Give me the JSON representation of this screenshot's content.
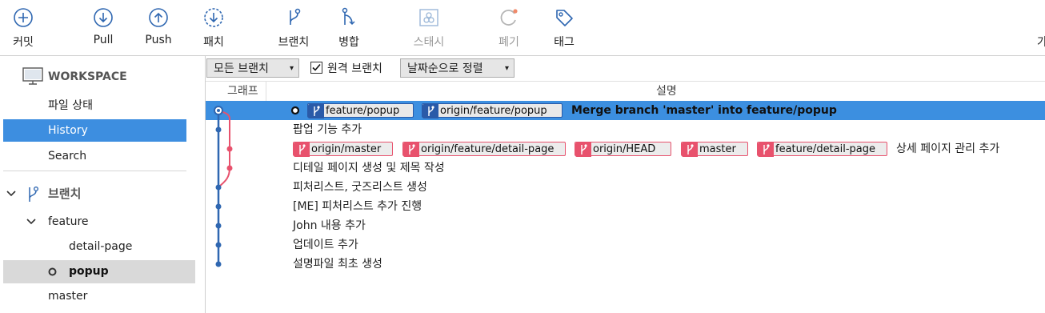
{
  "toolbar": {
    "items": [
      {
        "label": "커밋",
        "icon": "plus-circle-icon"
      },
      {
        "label": "Pull",
        "icon": "arrow-down-circle-icon"
      },
      {
        "label": "Push",
        "icon": "arrow-up-circle-icon"
      },
      {
        "label": "패치",
        "icon": "patch-icon"
      },
      {
        "label": "브랜치",
        "icon": "branch-icon"
      },
      {
        "label": "병합",
        "icon": "merge-icon"
      },
      {
        "label": "스태시",
        "icon": "stash-icon"
      },
      {
        "label": "폐기",
        "icon": "discard-icon"
      },
      {
        "label": "태그",
        "icon": "tag-icon"
      }
    ],
    "overflow_char": "가"
  },
  "sidebar": {
    "workspace": "WORKSPACE",
    "workspace_items": [
      "파일 상태",
      "History",
      "Search"
    ],
    "selected": "History",
    "branches_title": "브랜치",
    "branch_folder": "feature",
    "branch_children": [
      "detail-page",
      "popup"
    ],
    "current_branch": "popup",
    "other_branches": [
      "master"
    ]
  },
  "filters": {
    "branch_filter": "모든 브랜치",
    "remote_branches_label": "원격 브랜치",
    "remote_branches_checked": true,
    "sort": "날짜순으로 정렬"
  },
  "columns": {
    "graph": "그래프",
    "description": "설명"
  },
  "commits": [
    {
      "description": "Merge branch 'master' into feature/popup",
      "refs": [
        {
          "name": "feature/popup",
          "kind": "local"
        },
        {
          "name": "origin/feature/popup",
          "kind": "remote"
        }
      ],
      "selected": true
    },
    {
      "description": "팝업 기능 추가",
      "refs": []
    },
    {
      "description": "상세 페이지 관리 추가",
      "refs": [
        {
          "name": "origin/master",
          "kind": "remote"
        },
        {
          "name": "origin/feature/detail-page",
          "kind": "remote"
        },
        {
          "name": "origin/HEAD",
          "kind": "remote"
        },
        {
          "name": "master",
          "kind": "local"
        },
        {
          "name": "feature/detail-page",
          "kind": "local"
        }
      ]
    },
    {
      "description": "디테일 페이지 생성 및 제목 작성",
      "refs": []
    },
    {
      "description": "피처리스트, 굿즈리스트 생성",
      "refs": []
    },
    {
      "description": "[ME] 피처리스트 추가 진행",
      "refs": []
    },
    {
      "description": "John 내용 추가",
      "refs": []
    },
    {
      "description": "업데이트 추가",
      "refs": []
    },
    {
      "description": "설명파일 최초 생성",
      "refs": []
    }
  ],
  "colors": {
    "accent": "#3d8ee0",
    "graph_main": "#2f67b1",
    "graph_side": "#e8526d"
  }
}
